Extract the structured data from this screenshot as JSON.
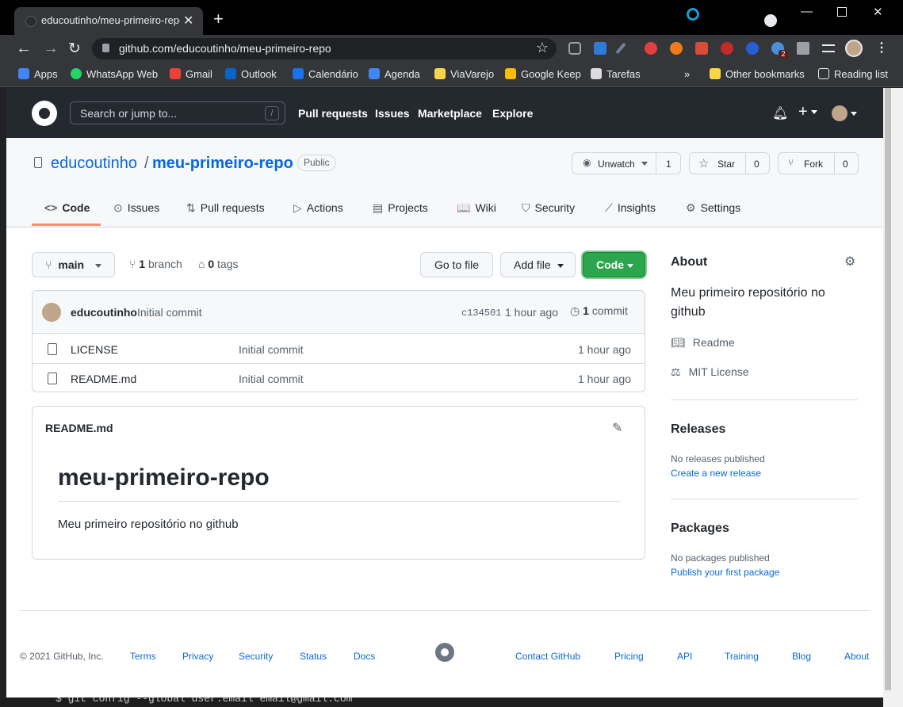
{
  "browser": {
    "tab_title": "educoutinho/meu-primeiro-repo",
    "url": "github.com/educoutinho/meu-primeiro-repo",
    "extension_badge": "2",
    "bookmarks": [
      {
        "label": "Apps",
        "color": "#4285f4"
      },
      {
        "label": "WhatsApp Web",
        "color": "#25d366"
      },
      {
        "label": "Gmail",
        "color": "#ea4335"
      },
      {
        "label": "Outlook",
        "color": "#0a64c8"
      },
      {
        "label": "Calendário",
        "color": "#1a73e8"
      },
      {
        "label": "Agenda",
        "color": "#4285f4"
      },
      {
        "label": "ViaVarejo",
        "color": "#f9d648"
      },
      {
        "label": "Google Keep",
        "color": "#fbbc04"
      },
      {
        "label": "Tarefas",
        "color": "#dddddd"
      }
    ],
    "more_bookmarks": "»",
    "other_bookmarks": "Other bookmarks",
    "reading_list": "Reading list"
  },
  "github_header": {
    "search_placeholder": "Search or jump to...",
    "search_shortcut": "/",
    "nav": [
      "Pull requests",
      "Issues",
      "Marketplace",
      "Explore"
    ]
  },
  "repo": {
    "owner": "educoutinho",
    "separator": "/",
    "name": "meu-primeiro-repo",
    "visibility": "Public",
    "watch_label": "Unwatch",
    "watch_count": "1",
    "star_label": "Star",
    "star_count": "0",
    "fork_label": "Fork",
    "fork_count": "0",
    "tabs": [
      {
        "icon": "<>",
        "label": "Code"
      },
      {
        "icon": "⊙",
        "label": "Issues"
      },
      {
        "icon": "⇅",
        "label": "Pull requests"
      },
      {
        "icon": "▷",
        "label": "Actions"
      },
      {
        "icon": "▤",
        "label": "Projects"
      },
      {
        "icon": "📖",
        "label": "Wiki"
      },
      {
        "icon": "⛉",
        "label": "Security"
      },
      {
        "icon": "⟋",
        "label": "Insights"
      },
      {
        "icon": "⚙",
        "label": "Settings"
      }
    ]
  },
  "file_nav": {
    "branch": "main",
    "branch_count": "1",
    "branch_word": "branch",
    "tag_count": "0",
    "tag_word": "tags",
    "go_to_file": "Go to file",
    "add_file": "Add file",
    "code": "Code"
  },
  "commit": {
    "author": "educoutinho",
    "message": "Initial commit",
    "sha": "c134501",
    "time": "1 hour ago",
    "count": "1",
    "count_word": "commit"
  },
  "files": [
    {
      "name": "LICENSE",
      "message": "Initial commit",
      "time": "1 hour ago"
    },
    {
      "name": "README.md",
      "message": "Initial commit",
      "time": "1 hour ago"
    }
  ],
  "readme": {
    "filename": "README.md",
    "heading": "meu-primeiro-repo",
    "body": "Meu primeiro repositório no github"
  },
  "about": {
    "title": "About",
    "description": "Meu primeiro repositório no github",
    "readme": "Readme",
    "license": "MIT License"
  },
  "releases": {
    "title": "Releases",
    "none": "No releases published",
    "create": "Create a new release"
  },
  "packages": {
    "title": "Packages",
    "none": "No packages published",
    "publish": "Publish your first package"
  },
  "footer": {
    "copyright": "© 2021 GitHub, Inc.",
    "left_links": [
      "Terms",
      "Privacy",
      "Security",
      "Status",
      "Docs"
    ],
    "right_links": [
      "Contact GitHub",
      "Pricing",
      "API",
      "Training",
      "Blog",
      "About"
    ]
  },
  "terminal_line": "$ git config --global user.email email@gmail.com",
  "colors": {
    "accent": "#2da44e",
    "link": "#0969da",
    "tab_underline": "#fd8c73"
  }
}
